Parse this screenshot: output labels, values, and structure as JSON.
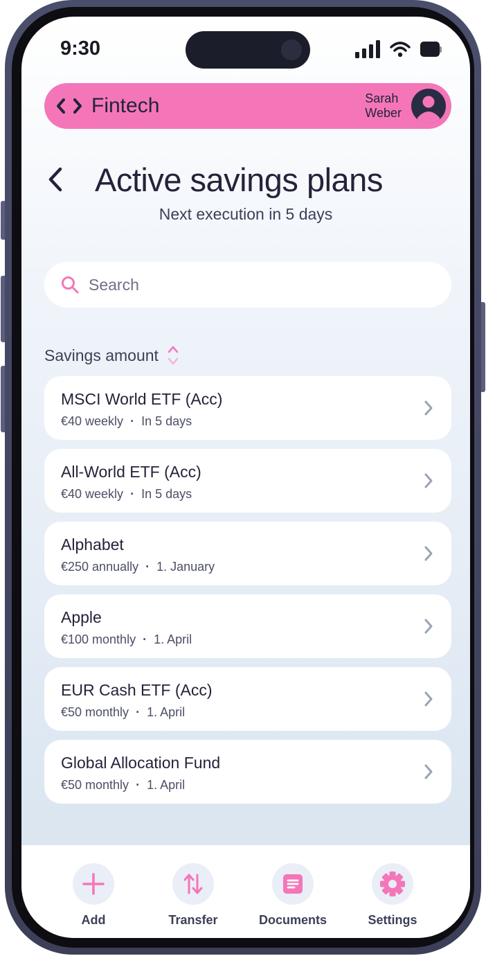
{
  "status_bar": {
    "time": "9:30"
  },
  "header": {
    "brand": "Fintech",
    "user_first": "Sarah",
    "user_last": "Weber"
  },
  "page": {
    "title": "Active savings plans",
    "subtitle": "Next execution in 5 days"
  },
  "search": {
    "placeholder": "Search",
    "value": ""
  },
  "sort": {
    "label": "Savings amount"
  },
  "plans": [
    {
      "name": "MSCI World ETF (Acc)",
      "amount": "€40 weekly",
      "next": "In 5 days"
    },
    {
      "name": "All-World ETF (Acc)",
      "amount": "€40 weekly",
      "next": "In 5 days"
    },
    {
      "name": "Alphabet",
      "amount": "€250 annually",
      "next": "1. January"
    },
    {
      "name": "Apple",
      "amount": "€100 monthly",
      "next": "1. April"
    },
    {
      "name": "EUR Cash ETF (Acc)",
      "amount": "€50 monthly",
      "next": "1. April"
    },
    {
      "name": "Global Allocation Fund",
      "amount": "€50 monthly",
      "next": "1. April"
    }
  ],
  "nav": [
    {
      "label": "Add",
      "icon": "plus-icon"
    },
    {
      "label": "Transfer",
      "icon": "transfer-icon"
    },
    {
      "label": "Documents",
      "icon": "document-icon"
    },
    {
      "label": "Settings",
      "icon": "gear-icon"
    }
  ],
  "colors": {
    "accent": "#f476b9",
    "text": "#23233a",
    "frame": "#4a4e6b"
  }
}
